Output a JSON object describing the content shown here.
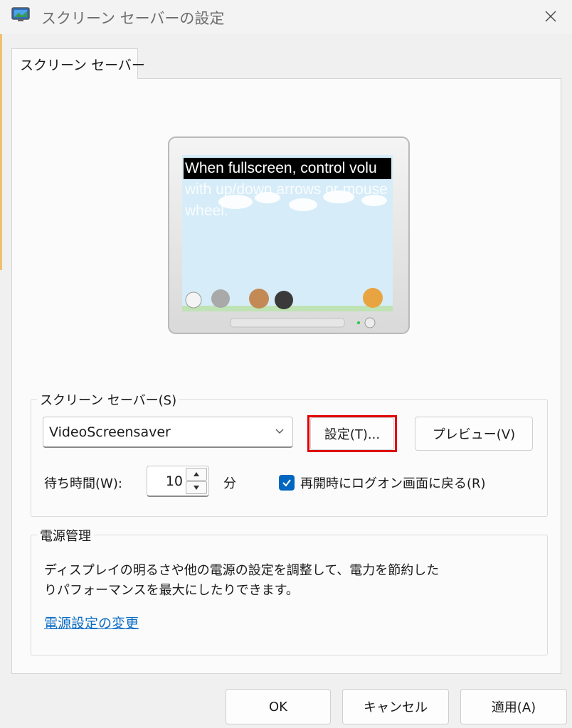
{
  "window": {
    "title": "スクリーン セーバーの設定",
    "icon": "screensaver-monitor-icon",
    "close_icon": "close-icon"
  },
  "tab": {
    "label": "スクリーン セーバー"
  },
  "preview": {
    "line1": "When fullscreen, control volu",
    "line2": "with up/down arrows or mouse",
    "line3": "wheel."
  },
  "screensaver_group": {
    "legend": "スクリーン セーバー(S)",
    "selected": "VideoScreensaver",
    "settings_button": "設定(T)...",
    "preview_button": "プレビュー(V)",
    "wait_label": "待ち時間(W):",
    "wait_value": "10",
    "wait_unit": "分",
    "resume_checkbox": {
      "label": "再開時にログオン画面に戻る(R)",
      "checked": true
    }
  },
  "power_group": {
    "legend": "電源管理",
    "description_line1": "ディスプレイの明るさや他の電源の設定を調整して、電力を節約した",
    "description_line2": "りパフォーマンスを最大にしたりできます。",
    "link": "電源設定の変更"
  },
  "footer": {
    "ok": "OK",
    "cancel": "キャンセル",
    "apply": "適用(A)"
  },
  "colors": {
    "accent": "#0067c0",
    "highlight": "#e00000",
    "link": "#0a6cc4"
  }
}
